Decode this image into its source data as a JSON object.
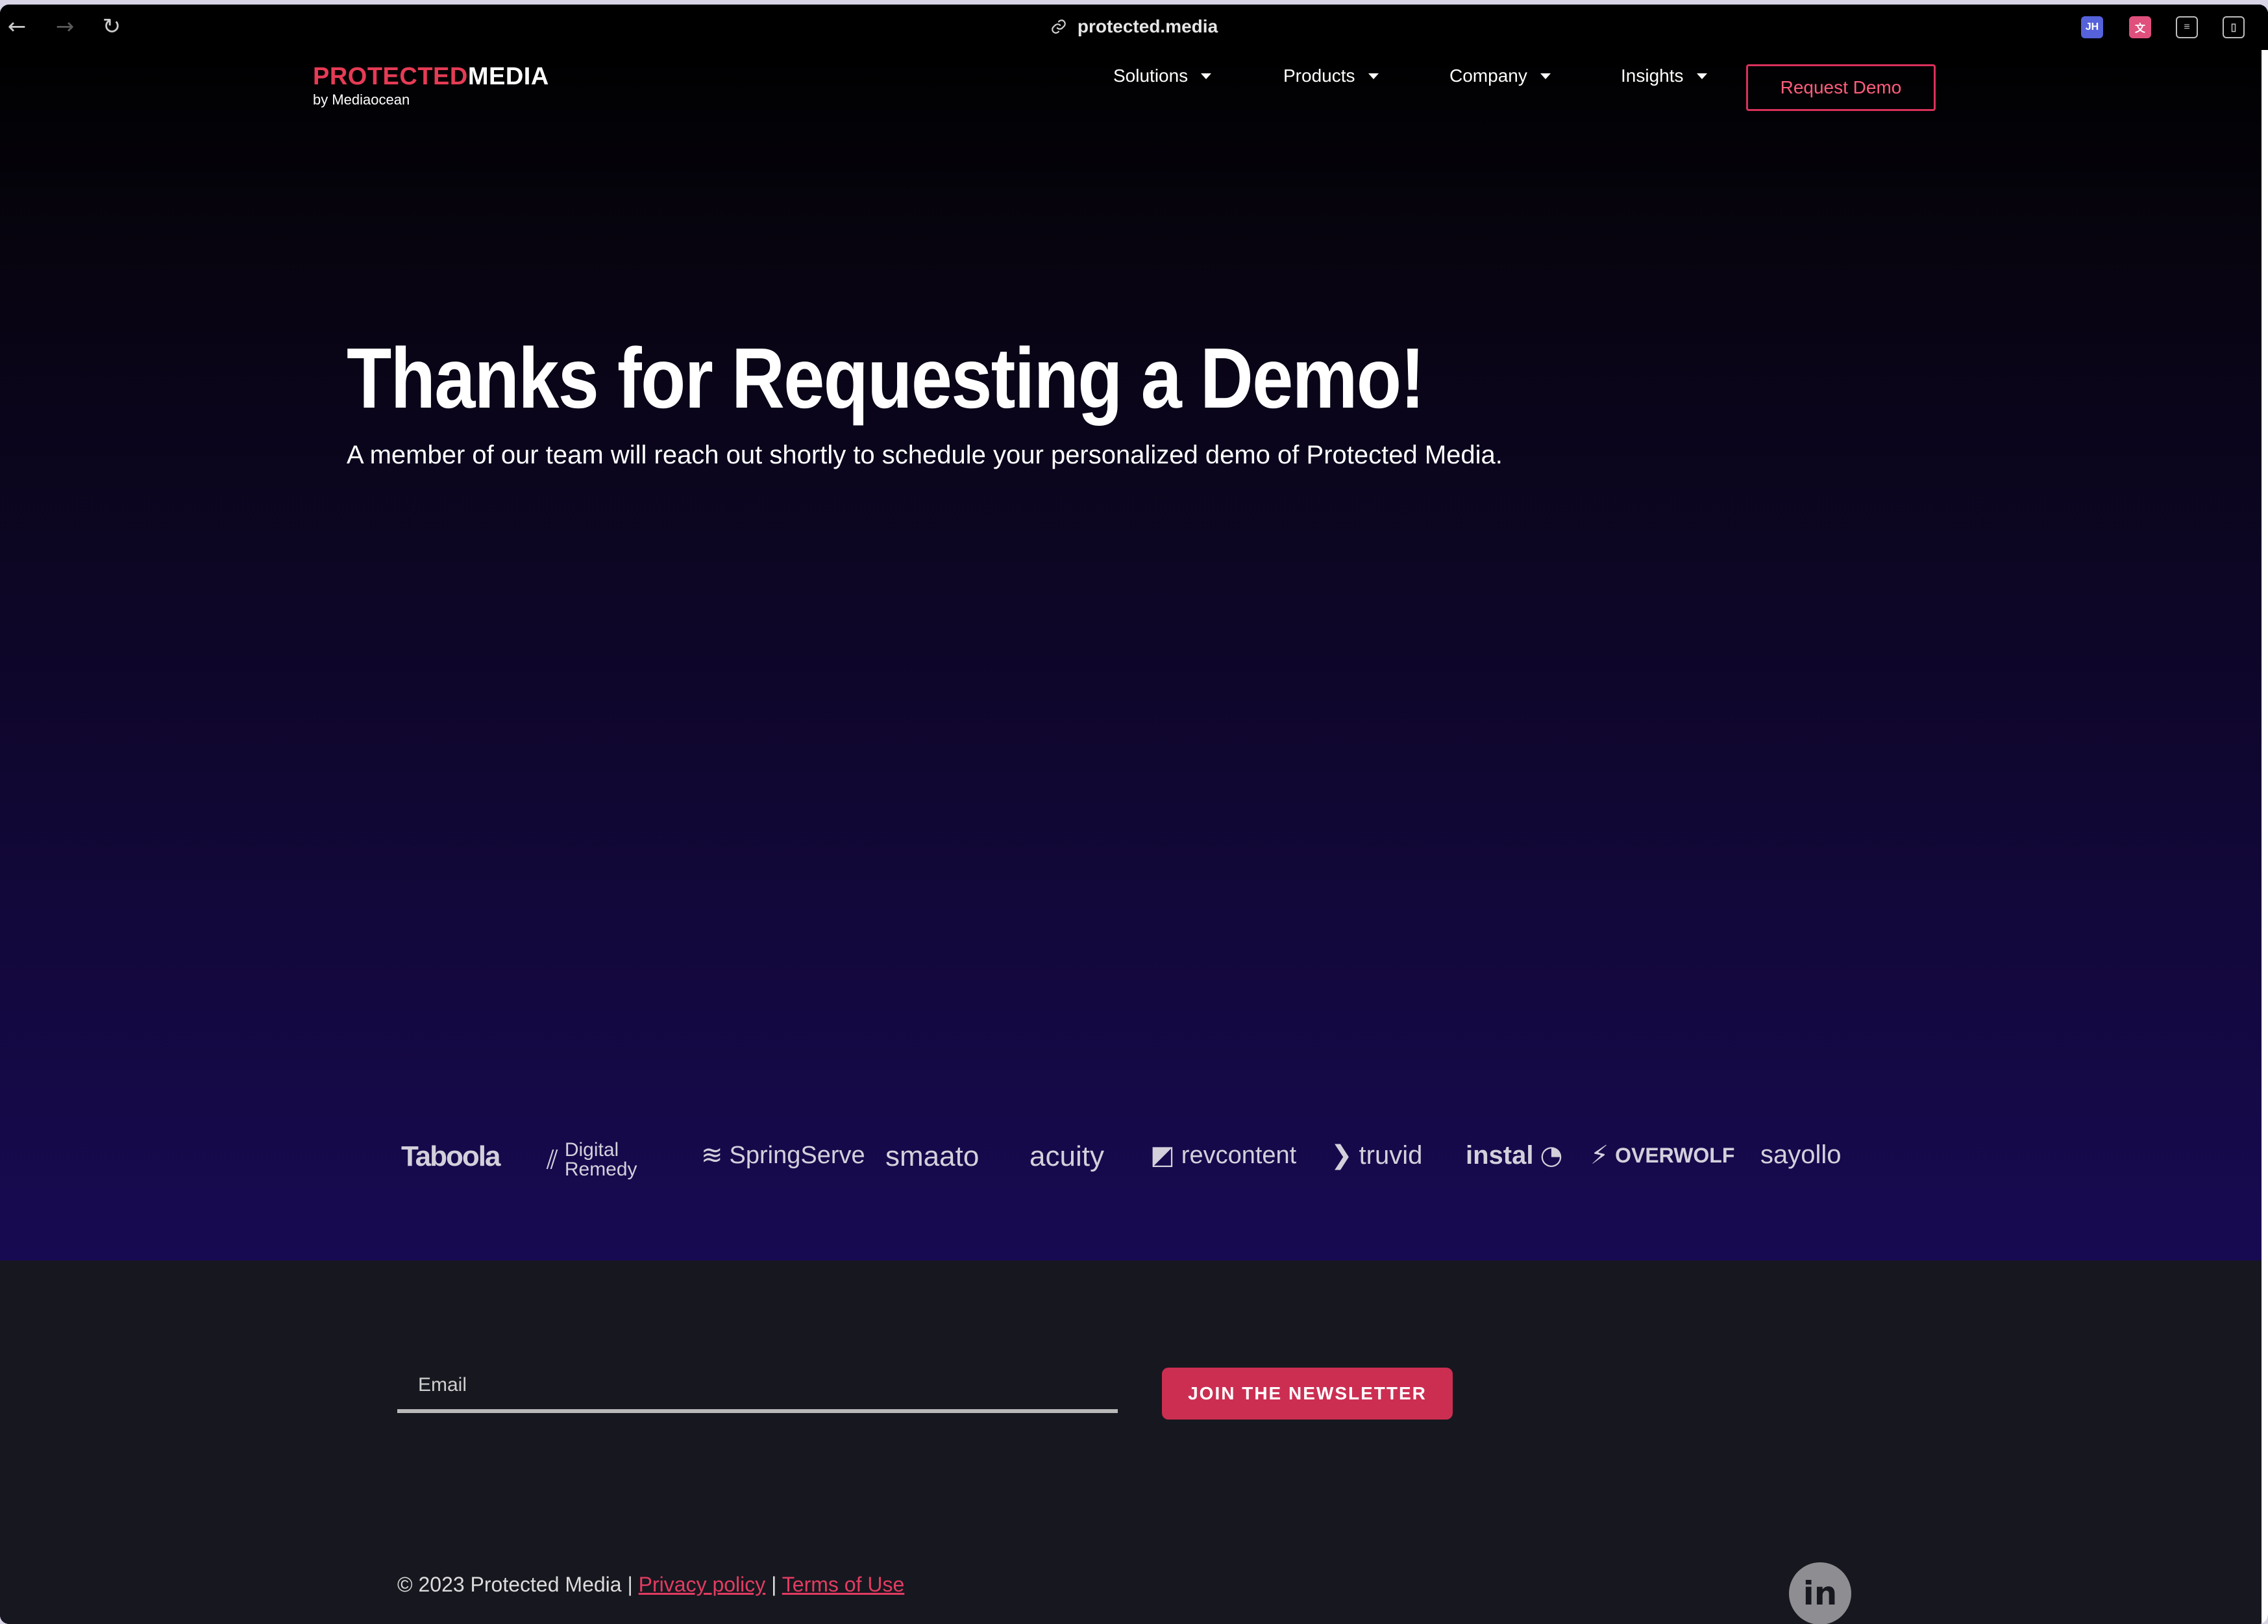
{
  "browser": {
    "url": "protected.media",
    "back_icon": "arrow-left-icon",
    "forward_icon": "arrow-right-icon",
    "reload_icon": "reload-icon",
    "extensions": [
      "JH",
      "translate-extension",
      "extension-icon",
      "sidebar-icon"
    ]
  },
  "header": {
    "brand_red": "PROTECTED",
    "brand_white": "MEDIA",
    "brand_sub": "by Mediaocean",
    "menu": [
      {
        "label": "Solutions"
      },
      {
        "label": "Products"
      },
      {
        "label": "Company"
      },
      {
        "label": "Insights"
      }
    ],
    "cta": "Request Demo"
  },
  "hero": {
    "title": "Thanks for Requesting a Demo!",
    "subtitle": "A member of our team will reach out shortly to schedule your personalized demo of Protected Media."
  },
  "client_logos": [
    "Taboola",
    "Digital Remedy",
    "SpringServe",
    "smaato",
    "acuity",
    "revcontent",
    "truvid",
    "instal",
    "OVERWOLF",
    "sayollo"
  ],
  "footer": {
    "email_placeholder": "Email",
    "newsletter_button": "JOIN THE NEWSLETTER",
    "copyright": "© 2023 Protected Media |",
    "privacy": "Privacy policy",
    "separator": "|",
    "terms": "Terms of Use",
    "social_icon": "linkedin-icon"
  },
  "colors": {
    "accent": "#cc2e52",
    "brand_red": "#e63b55",
    "footer_bg": "#17171f"
  }
}
